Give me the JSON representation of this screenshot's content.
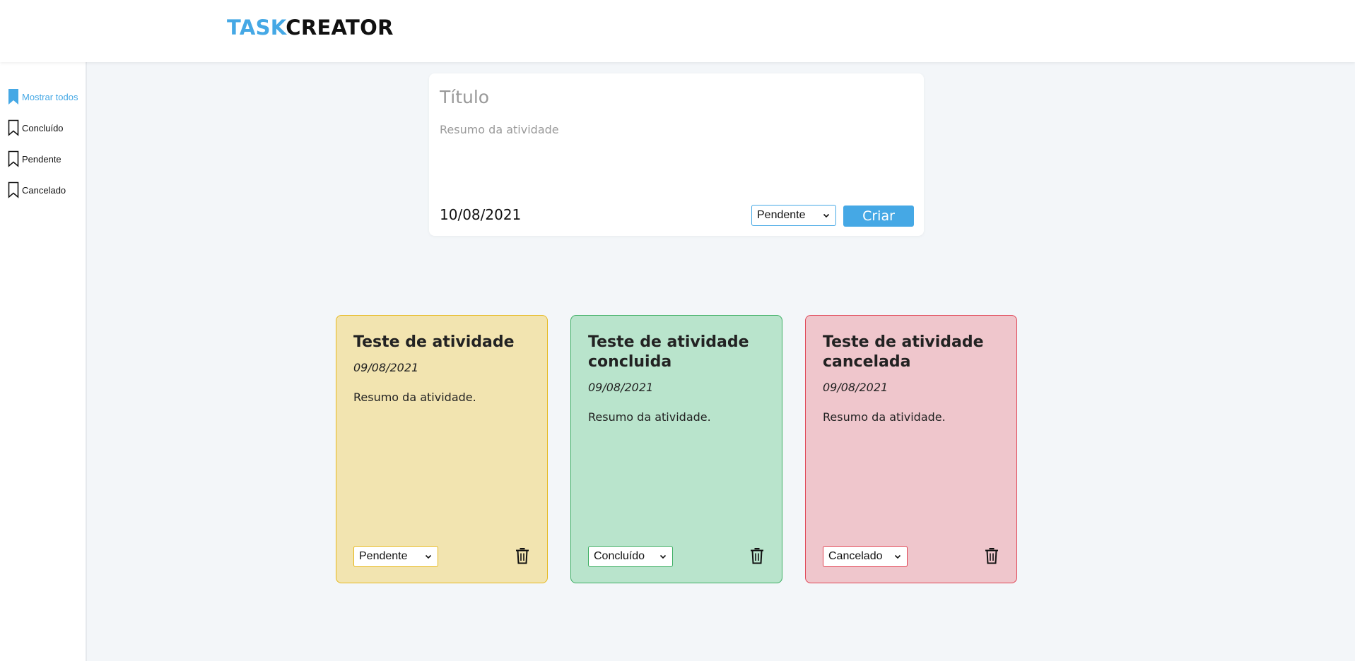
{
  "header": {
    "logo_part1": "TASK",
    "logo_part2": "CREATOR"
  },
  "sidebar": {
    "items": [
      {
        "label": "Mostrar todos",
        "active": true
      },
      {
        "label": "Concluído",
        "active": false
      },
      {
        "label": "Pendente",
        "active": false
      },
      {
        "label": "Cancelado",
        "active": false
      }
    ]
  },
  "form": {
    "title_placeholder": "Título",
    "summary_placeholder": "Resumo da atividade",
    "date": "10/08/2021",
    "status_value": "Pendente",
    "create_label": "Criar"
  },
  "cards": [
    {
      "title": "Teste de atividade",
      "date": "09/08/2021",
      "summary": "Resumo da atividade.",
      "status": "Pendente"
    },
    {
      "title": "Teste de atividade concluida",
      "date": "09/08/2021",
      "summary": "Resumo da atividade.",
      "status": "Concluído"
    },
    {
      "title": "Teste de atividade cancelada",
      "date": "09/08/2021",
      "summary": "Resumo da atividade.",
      "status": "Cancelado"
    }
  ],
  "colors": {
    "accent": "#45a8e5",
    "pending_bg": "#f2e4b0",
    "pending_border": "#e6b91f",
    "done_bg": "#b9e4cc",
    "done_border": "#3dae63",
    "cancel_bg": "#efc6cc",
    "cancel_border": "#e04555"
  },
  "icons": {
    "sidebar_active": "bookmark-filled-icon",
    "sidebar_inactive": "bookmark-outline-icon",
    "select": "chevron-down-icon",
    "delete": "trash-icon"
  }
}
